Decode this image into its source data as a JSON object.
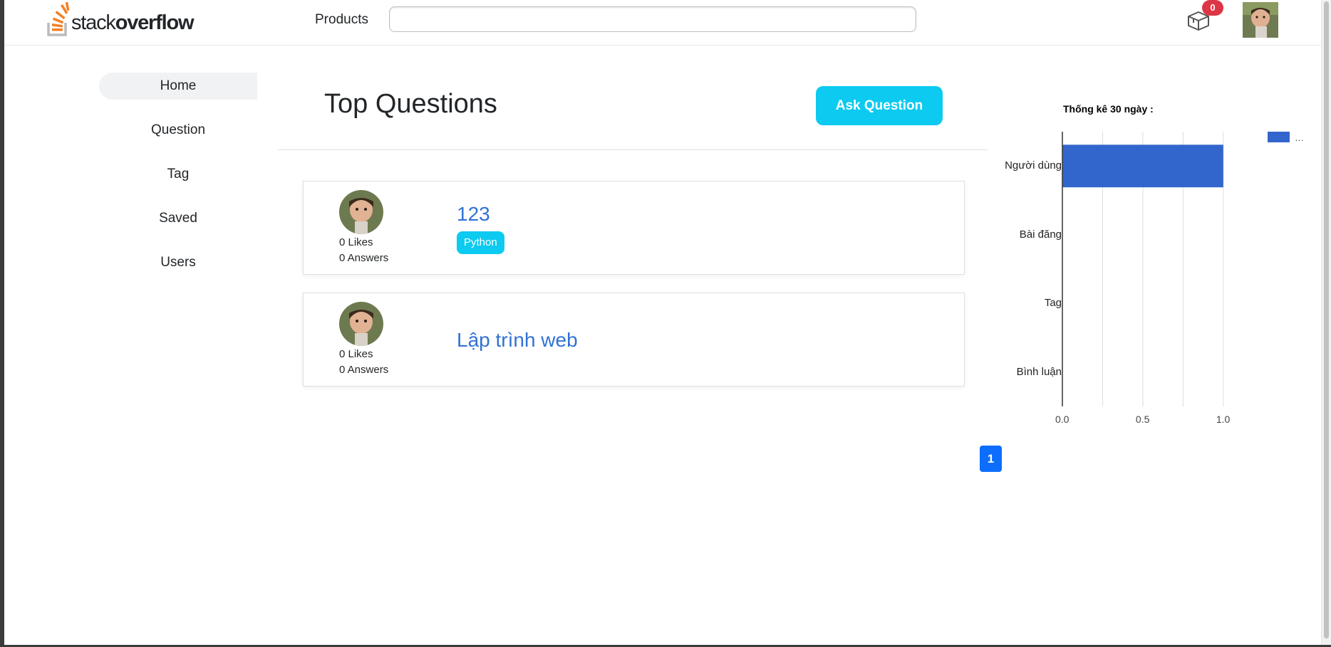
{
  "header": {
    "logo_text_light": "stack",
    "logo_text_bold": "overflow",
    "products_label": "Products",
    "search_placeholder": "",
    "inbox_count": "0"
  },
  "sidebar": {
    "items": [
      {
        "label": "Home",
        "active": true
      },
      {
        "label": "Question",
        "active": false
      },
      {
        "label": "Tag",
        "active": false
      },
      {
        "label": "Saved",
        "active": false
      },
      {
        "label": "Users",
        "active": false
      }
    ]
  },
  "main": {
    "title": "Top Questions",
    "ask_button": "Ask Question",
    "questions": [
      {
        "likes": "0 Likes",
        "answers": "0 Answers",
        "title": "123",
        "tag": "Python"
      },
      {
        "likes": "0 Likes",
        "answers": "0 Answers",
        "title": "Lập trình web",
        "tag": ""
      }
    ]
  },
  "pagination": {
    "current": "1"
  },
  "colors": {
    "accent_cyan": "#0dcaf0",
    "link_blue": "#3172d4",
    "bar_blue": "#3366cc",
    "badge_red": "#dc3545",
    "pager_blue": "#0d6efd"
  },
  "chart_data": {
    "type": "bar",
    "orientation": "horizontal",
    "title": "Thống kê 30 ngày :",
    "categories": [
      "Người dùng",
      "Bài đăng",
      "Tag",
      "Bình luận"
    ],
    "values": [
      1,
      0,
      0,
      0
    ],
    "xlim": [
      0,
      1.2
    ],
    "xticks": [
      "0.0",
      "0.5",
      "1.0"
    ],
    "grid": true,
    "legend": "top-right",
    "legend_text": "…"
  }
}
